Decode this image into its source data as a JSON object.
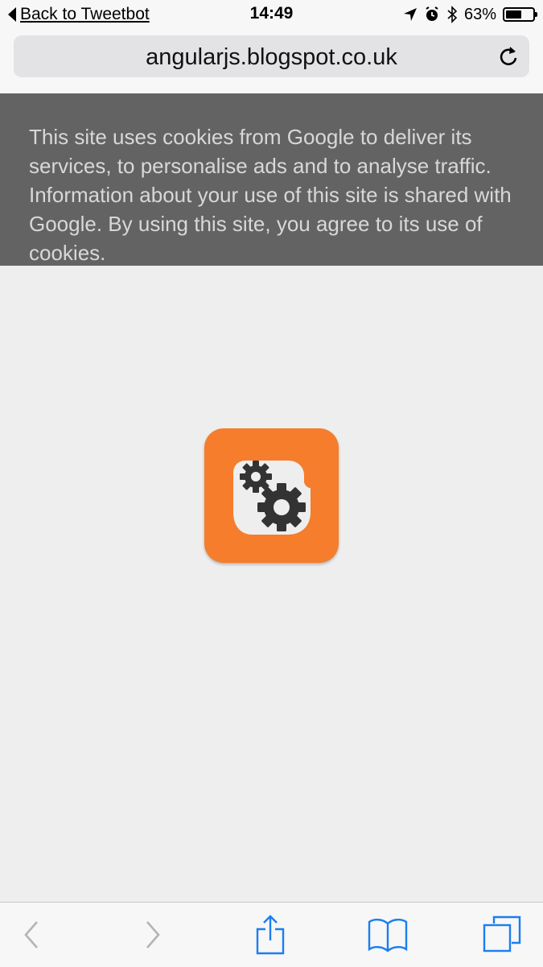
{
  "status_bar": {
    "back_label": "Back to Tweetbot",
    "time": "14:49",
    "battery_percent": "63%",
    "battery_level": 0.63,
    "icons": [
      "location-arrow-icon",
      "alarm-icon",
      "bluetooth-icon",
      "battery-icon"
    ]
  },
  "browser": {
    "url": "angularjs.blogspot.co.uk",
    "reload_icon": "reload-icon"
  },
  "cookie_notice": {
    "text": "This site uses cookies from Google to deliver its services, to personalise ads and to analyse traffic. Information about your use of this site is shared with Google. By using this site, you agree to its use of cookies."
  },
  "page": {
    "logo_icon": "blogger-gears-logo",
    "colors": {
      "logo_orange": "#f57d2c",
      "page_background": "#eeeeee",
      "banner_background": "#636363",
      "toolbar_blue": "#1a7ef0",
      "toolbar_disabled": "#b4b4b4"
    }
  },
  "toolbar": {
    "buttons": [
      "back-icon",
      "forward-icon",
      "share-icon",
      "bookmarks-icon",
      "tabs-icon"
    ]
  }
}
